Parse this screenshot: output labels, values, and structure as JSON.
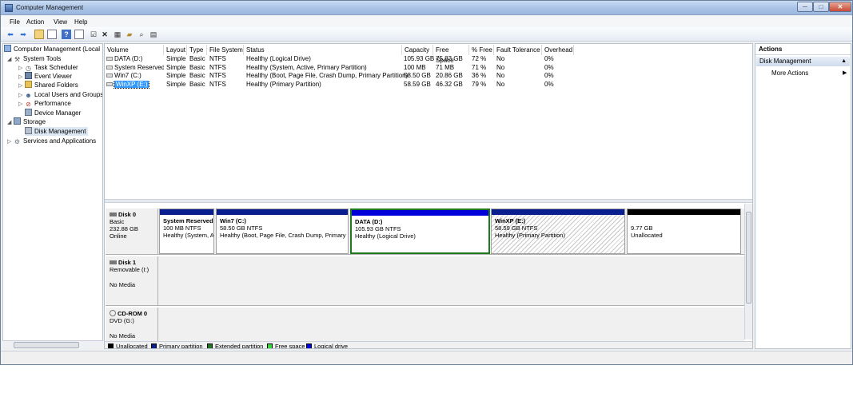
{
  "window": {
    "title": "Computer Management",
    "controls": {
      "min": "─",
      "max": "□",
      "close": "✕"
    }
  },
  "menu": [
    "File",
    "Action",
    "View",
    "Help"
  ],
  "tree": [
    {
      "label": "Computer Management (Local",
      "icon": "computer-icon",
      "level": 0,
      "arrow": ""
    },
    {
      "label": "System Tools",
      "icon": "tools-icon",
      "level": 1,
      "arrow": "◢"
    },
    {
      "label": "Task Scheduler",
      "icon": "clock-icon",
      "level": 2,
      "arrow": "▷"
    },
    {
      "label": "Event Viewer",
      "icon": "event-viewer-icon",
      "level": 2,
      "arrow": "▷"
    },
    {
      "label": "Shared Folders",
      "icon": "shared-folder-icon",
      "level": 2,
      "arrow": "▷"
    },
    {
      "label": "Local Users and Groups",
      "icon": "users-icon",
      "level": 2,
      "arrow": "▷"
    },
    {
      "label": "Performance",
      "icon": "performance-icon",
      "level": 2,
      "arrow": "▷"
    },
    {
      "label": "Device Manager",
      "icon": "device-manager-icon",
      "level": 2,
      "arrow": ""
    },
    {
      "label": "Storage",
      "icon": "storage-icon",
      "level": 1,
      "arrow": "◢"
    },
    {
      "label": "Disk Management",
      "icon": "disk-icon",
      "level": 2,
      "arrow": ""
    },
    {
      "label": "Services and Applications",
      "icon": "services-icon",
      "level": 1,
      "arrow": "▷"
    }
  ],
  "volumes": {
    "headers": [
      "Volume",
      "Layout",
      "Type",
      "File System",
      "Status",
      "Capacity",
      "Free Space",
      "% Free",
      "Fault Tolerance",
      "Overhead"
    ],
    "rows": [
      [
        "DATA (D:)",
        "Simple",
        "Basic",
        "NTFS",
        "Healthy (Logical Drive)",
        "105.93 GB",
        "75.83 GB",
        "72 %",
        "No",
        "0%"
      ],
      [
        "System Reserved",
        "Simple",
        "Basic",
        "NTFS",
        "Healthy (System, Active, Primary Partition)",
        "100 MB",
        "71 MB",
        "71 %",
        "No",
        "0%"
      ],
      [
        "Win7 (C:)",
        "Simple",
        "Basic",
        "NTFS",
        "Healthy (Boot, Page File, Crash Dump, Primary Partition)",
        "58.50 GB",
        "20.86 GB",
        "36 %",
        "No",
        "0%"
      ],
      [
        "WinXP (E:)",
        "Simple",
        "Basic",
        "NTFS",
        "Healthy (Primary Partition)",
        "58.59 GB",
        "46.32 GB",
        "79 %",
        "No",
        "0%"
      ]
    ]
  },
  "disks": [
    {
      "name": "Disk 0",
      "type": "Basic",
      "size": "232.88 GB",
      "state": "Online"
    },
    {
      "name": "Disk 1",
      "type": "Removable (I:)",
      "size": "",
      "state": "No Media"
    },
    {
      "name": "CD-ROM 0",
      "type": "DVD (G:)",
      "size": "",
      "state": "No Media"
    }
  ],
  "partitions": [
    {
      "name": "System Reserved",
      "size": "100 MB NTFS",
      "status": "Healthy (System, A",
      "color": "#0a1f8f"
    },
    {
      "name": "Win7  (C:)",
      "size": "58.50 GB NTFS",
      "status": "Healthy (Boot, Page File, Crash Dump, Primary",
      "color": "#0a1f8f"
    },
    {
      "name": "DATA  (D:)",
      "size": "105.93 GB NTFS",
      "status": "Healthy (Logical Drive)",
      "color": "#0000d8"
    },
    {
      "name": "WinXP  (E:)",
      "size": "58.59 GB NTFS",
      "status": "Healthy (Primary Partition)",
      "color": "#0a1f8f"
    },
    {
      "name": "",
      "size": "9.77 GB",
      "status": "Unallocated",
      "color": "#000000"
    }
  ],
  "legend": [
    {
      "label": "Unallocated",
      "color": "#000000"
    },
    {
      "label": "Primary partition",
      "color": "#0a1f8f"
    },
    {
      "label": "Extended partition",
      "color": "#1f7a1f"
    },
    {
      "label": "Free space",
      "color": "#33dd33"
    },
    {
      "label": "Logical drive",
      "color": "#0000d8"
    }
  ],
  "actions": {
    "header": "Actions",
    "section": "Disk Management",
    "item": "More Actions"
  }
}
